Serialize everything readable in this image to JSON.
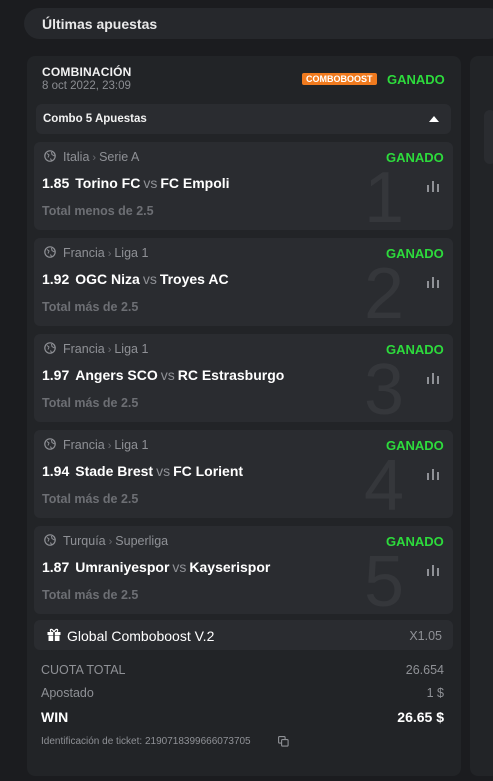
{
  "header": {
    "title": "Últimas apuestas"
  },
  "bet": {
    "type": "COMBINACIÓN",
    "date": "8 oct 2022, 23:09",
    "badge": "COMBOBOOST",
    "status": "GANADO",
    "combo_label": "Combo 5 Apuestas",
    "legs": [
      {
        "number": "1",
        "country": "Italia",
        "league": "Serie A",
        "status": "GANADO",
        "odds": "1.85",
        "home": "Torino FC",
        "vs": "vs",
        "away": "FC Empoli",
        "market": "Total menos de 2.5"
      },
      {
        "number": "2",
        "country": "Francia",
        "league": "Liga 1",
        "status": "GANADO",
        "odds": "1.92",
        "home": "OGC Niza",
        "vs": "vs",
        "away": "Troyes AC",
        "market": "Total más de 2.5"
      },
      {
        "number": "3",
        "country": "Francia",
        "league": "Liga 1",
        "status": "GANADO",
        "odds": "1.97",
        "home": "Angers SCO",
        "vs": "vs",
        "away": "RC Estrasburgo",
        "market": "Total más de 2.5"
      },
      {
        "number": "4",
        "country": "Francia",
        "league": "Liga 1",
        "status": "GANADO",
        "odds": "1.94",
        "home": "Stade Brest",
        "vs": "vs",
        "away": "FC Lorient",
        "market": "Total más de 2.5"
      },
      {
        "number": "5",
        "country": "Turquía",
        "league": "Superliga",
        "status": "GANADO",
        "odds": "1.87",
        "home": "Umraniyespor",
        "vs": "vs",
        "away": "Kayserispor",
        "market": "Total más de 2.5"
      }
    ],
    "boost": {
      "label": "Global Comboboost V.2",
      "multiplier": "X1.05"
    },
    "summary": {
      "total_odds_label": "CUOTA TOTAL",
      "total_odds_value": "26.654",
      "stake_label": "Apostado",
      "stake_value": "1 $",
      "win_label": "WIN",
      "win_value": "26.65 $"
    },
    "ticket": {
      "label": "Identificación de ticket:",
      "id": "2190718399666073705"
    }
  },
  "colors": {
    "won": "#2ddb3c",
    "badge": "#f07a1e",
    "card": "#222427",
    "row": "#2a2c30"
  },
  "icons": [
    "globe-icon",
    "stats-icon",
    "chevron-up-icon",
    "gift-icon",
    "copy-icon"
  ]
}
